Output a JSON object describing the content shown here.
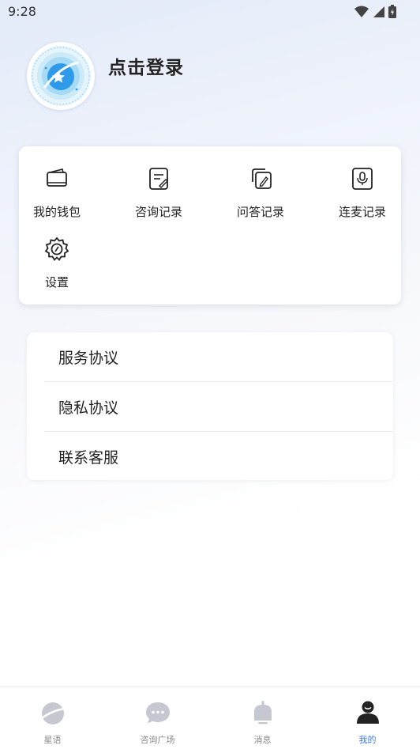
{
  "status_bar": {
    "time": "9:28"
  },
  "profile": {
    "login_text": "点击登录"
  },
  "functions": [
    {
      "label": "我的钱包",
      "icon": "wallet-icon"
    },
    {
      "label": "咨询记录",
      "icon": "consult-record-icon"
    },
    {
      "label": "问答记录",
      "icon": "qa-record-icon"
    },
    {
      "label": "连麦记录",
      "icon": "mic-record-icon"
    },
    {
      "label": "设置",
      "icon": "settings-icon"
    }
  ],
  "links": [
    {
      "label": "服务协议"
    },
    {
      "label": "隐私协议"
    },
    {
      "label": "联系客服"
    }
  ],
  "bottom_nav": [
    {
      "label": "星语",
      "icon": "planet-icon",
      "active": false
    },
    {
      "label": "咨询广场",
      "icon": "chat-bubble-icon",
      "active": false
    },
    {
      "label": "消息",
      "icon": "bell-icon",
      "active": false
    },
    {
      "label": "我的",
      "icon": "user-icon",
      "active": true
    }
  ],
  "colors": {
    "active": "#3a7be0",
    "inactive_icon": "#c5c8d0",
    "text": "#222222"
  }
}
